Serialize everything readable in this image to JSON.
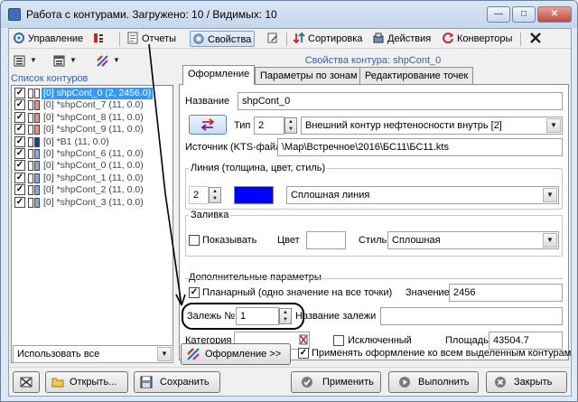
{
  "window": {
    "title": "Работа с контурами. Загружено: 10 / Видимых: 10",
    "min": "—",
    "max": "□",
    "close": "✕"
  },
  "menu": {
    "manage": "Управление",
    "reports": "Отчеты",
    "properties": "Свойства",
    "sort": "Сортировка",
    "actions": "Действия",
    "converters": "Конверторы"
  },
  "left": {
    "list_label": "Список контуров",
    "items": [
      {
        "label": "[0] shpCont_0 (2, 2456.0)",
        "checked": true,
        "color1": "#ffffff",
        "color2": "#ffffff",
        "selected": true
      },
      {
        "label": "[0] *shpCont_7 (11, 0.0)",
        "checked": true,
        "color1": "#ffffff",
        "color2": "#e89090"
      },
      {
        "label": "[0] *shpCont_8 (11, 0.0)",
        "checked": true,
        "color1": "#ffffff",
        "color2": "#e89090"
      },
      {
        "label": "[0] *shpCont_9 (11, 0.0)",
        "checked": true,
        "color1": "#ffffff",
        "color2": "#e89090"
      },
      {
        "label": "[0] *B1 (11, 0.0)",
        "checked": true,
        "color1": "#ffffff",
        "color2": "#1f3fa0"
      },
      {
        "label": "[0] *shpCont_6 (11, 0.0)",
        "checked": true,
        "color1": "#ffffff",
        "color2": "#8aa8d8"
      },
      {
        "label": "[0] *shpCont_0 (11, 0.0)",
        "checked": true,
        "color1": "#ffffff",
        "color2": "#8aa8d8"
      },
      {
        "label": "[0] *shpCont_1 (11, 0.0)",
        "checked": true,
        "color1": "#ffffff",
        "color2": "#8aa8d8"
      },
      {
        "label": "[0] *shpCont_2 (11, 0.0)",
        "checked": true,
        "color1": "#ffffff",
        "color2": "#8aa8d8"
      },
      {
        "label": "[0] *shpCont_3 (11, 0.0)",
        "checked": true,
        "color1": "#ffffff",
        "color2": "#8aa8d8"
      }
    ],
    "use_select": "Использовать все"
  },
  "right": {
    "props_title": "Свойства контура: shpCont_0",
    "tabs": [
      "Оформление",
      "Параметры по зонам",
      "Редактирование точек"
    ],
    "name_label": "Название",
    "name_value": "shpCont_0",
    "type_label": "Тип",
    "type_value": "2",
    "type_select": "Внешний контур нефтеносности внутрь [2]",
    "source_label": "Источник (KTS-файл)",
    "source_value": "\\Map\\Встречное\\2016\\БС11\\БС11.kts",
    "line_group": "Линия (толщина, цвет, стиль)",
    "line_width": "2",
    "line_color": "#0000ff",
    "line_style": "Сплошная линия",
    "fill_group": "Заливка",
    "fill_show": "Показывать",
    "fill_color_label": "Цвет",
    "fill_style_label": "Стиль",
    "fill_style": "Сплошная",
    "extra_group": "Дополнительные параметры",
    "planar_label": "Планарный (одно значение на все точки)",
    "value_label": "Значение",
    "value_value": "2456",
    "deposit_label": "Залежь №",
    "deposit_value": "1",
    "deposit_name_label": "Название залежи",
    "category_label": "Категория",
    "excluded_label": "Исключенный",
    "area_label": "Площадь",
    "area_value": "43504.7",
    "design_button": "Оформление >>",
    "apply_all_label": "Применять оформление ко всем выделенным контурам"
  },
  "bottom": {
    "open": "Открыть...",
    "save": "Сохранить",
    "apply": "Применить",
    "run": "Выполнить",
    "close": "Закрыть"
  }
}
